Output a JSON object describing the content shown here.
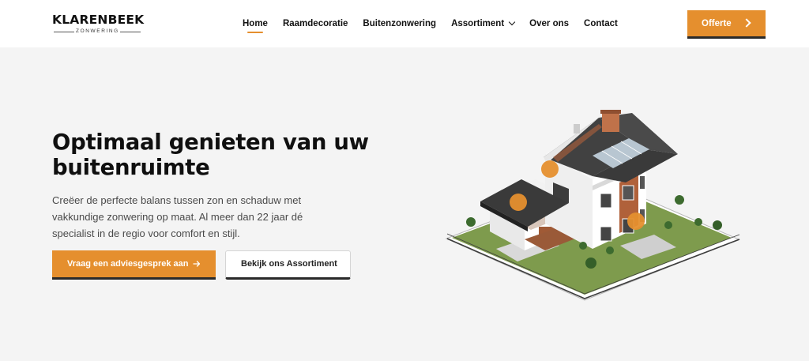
{
  "header": {
    "logo": {
      "title": "KLARENBEEK",
      "subtitle": "ZONWERING"
    },
    "nav": [
      {
        "label": "Home",
        "active": true
      },
      {
        "label": "Raamdecoratie"
      },
      {
        "label": "Buitenzonwering"
      },
      {
        "label": "Assortiment",
        "icon": "chevron-down-icon"
      },
      {
        "label": "Over ons"
      },
      {
        "label": "Contact"
      }
    ],
    "cta": {
      "label": "Offerte",
      "icon": "chevron-right-icon"
    }
  },
  "hero": {
    "title": "Optimaal genieten van uw buitenruimte",
    "text": "Creëer de perfecte balans tussen zon en schaduw met vakkundige zonwering op maat. Al meer dan 22 jaar dé specialist in de regio voor comfort en stijl.",
    "primary_button": {
      "label": "Vraag een adviesgesprek aan",
      "icon": "arrow-right-icon"
    },
    "secondary_button": {
      "label": "Bekijk ons Assortiment"
    },
    "image": {
      "alt": "house-illustration-with-hotspots",
      "hotspot_count": 3
    }
  },
  "colors": {
    "accent": "#e58f2e",
    "button_border": "#2a2a2a",
    "hero_background": "#f4f4f4",
    "header_background": "#ffffff",
    "text_dark": "#0f0f0f",
    "text_muted": "#4a4a4a"
  }
}
